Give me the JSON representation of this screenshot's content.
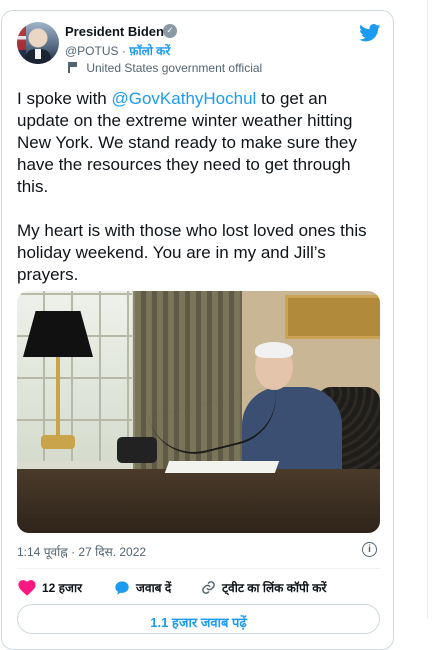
{
  "author": {
    "name": "President Biden",
    "handle": "@POTUS",
    "separator": "·",
    "follow_label": "फ़ॉलो करें",
    "label": "United States government official"
  },
  "tweet": {
    "text_part1": "I spoke with ",
    "mention": "@GovKathyHochul",
    "text_part2": " to get an update on the extreme winter weather hitting New York. We stand ready to make sure they have the resources they need to get through this.\n\nMy heart is with those who lost loved ones this holiday weekend. You are in my and Jill’s prayers."
  },
  "meta": {
    "timestamp": "1:14 पूर्वाह्न · 27 दिस. 2022"
  },
  "actions": {
    "likes": "12 हजार",
    "reply": "जवाब दें",
    "copy_link": "ट्वीट का लिंक कॉपी करें"
  },
  "bottom_button": {
    "label": "1.1 हजार जवाब पढ़ें"
  },
  "icons": [
    "verified-icon",
    "twitter-icon",
    "flag-icon",
    "info-icon",
    "heart-icon",
    "reply-icon",
    "link-icon"
  ],
  "colors": {
    "accent": "#1d9bf0",
    "like": "#f91880",
    "muted": "#536471"
  }
}
